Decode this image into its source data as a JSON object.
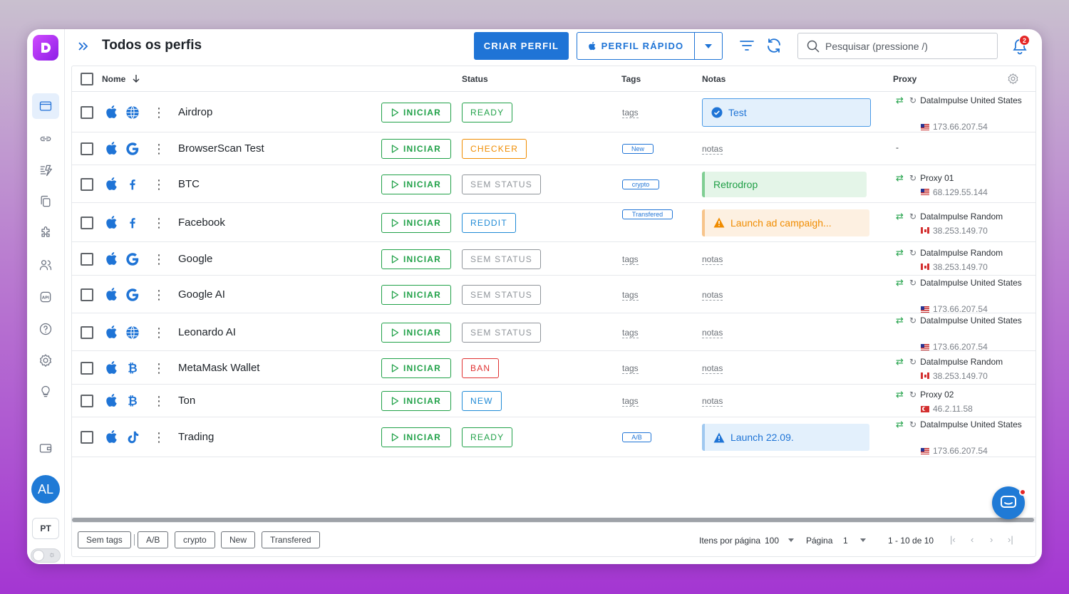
{
  "header": {
    "title": "Todos os perfis",
    "create_label": "CRIAR PERFIL",
    "quick_label": "PERFIL RÁPIDO",
    "search_placeholder": "Pesquisar (pressione /)",
    "notifications_count": "2"
  },
  "sidebar": {
    "items": [
      "profiles-icon",
      "link-icon",
      "automation-icon",
      "copy-icon",
      "extensions-icon",
      "team-icon",
      "api-icon",
      "help-icon",
      "settings-icon",
      "idea-icon",
      "wallet-icon"
    ],
    "avatar": "AL",
    "language": "PT"
  },
  "table": {
    "columns": {
      "name": "Nome",
      "status": "Status",
      "tags": "Tags",
      "notes": "Notas",
      "proxy": "Proxy"
    },
    "start_label": "INICIAR",
    "rows": [
      {
        "name": "Airdrop",
        "browser": "globe",
        "status": "READY",
        "status_color": "#20a148",
        "tags": "tags",
        "tag_chip": "",
        "note": "Test",
        "note_type": "info-check",
        "proxy_name": "DataImpulse United States",
        "proxy_ip": "173.66.207.54",
        "proxy_flag": "us"
      },
      {
        "name": "BrowserScan Test",
        "browser": "google",
        "status": "CHECKER",
        "status_color": "#f08c00",
        "tags": "",
        "tag_chip": "New",
        "note": "notas",
        "note_type": "link",
        "proxy_name": "-",
        "proxy_ip": "",
        "proxy_flag": ""
      },
      {
        "name": "BTC",
        "browser": "facebook",
        "status": "SEM STATUS",
        "status_color": "#8f949a",
        "tags": "",
        "tag_chip": "crypto",
        "note": "Retrodrop",
        "note_type": "success",
        "proxy_name": "Proxy 01",
        "proxy_ip": "68.129.55.144",
        "proxy_flag": "us"
      },
      {
        "name": "Facebook",
        "browser": "facebook",
        "status": "REDDIT",
        "status_color": "#1f8ad6",
        "tags": "",
        "tag_chip": "Transfered",
        "note": "Launch ad campaigh...",
        "note_type": "warning",
        "proxy_name": "DataImpulse Random",
        "proxy_ip": "38.253.149.70",
        "proxy_flag": "ca"
      },
      {
        "name": "Google",
        "browser": "google",
        "status": "SEM STATUS",
        "status_color": "#8f949a",
        "tags": "tags",
        "tag_chip": "",
        "note": "notas",
        "note_type": "link",
        "proxy_name": "DataImpulse Random",
        "proxy_ip": "38.253.149.70",
        "proxy_flag": "ca"
      },
      {
        "name": "Google AI",
        "browser": "google",
        "status": "SEM STATUS",
        "status_color": "#8f949a",
        "tags": "tags",
        "tag_chip": "",
        "note": "notas",
        "note_type": "link",
        "proxy_name": "DataImpulse United States",
        "proxy_ip": "173.66.207.54",
        "proxy_flag": "us"
      },
      {
        "name": "Leonardo AI",
        "browser": "globe",
        "status": "SEM STATUS",
        "status_color": "#8f949a",
        "tags": "tags",
        "tag_chip": "",
        "note": "notas",
        "note_type": "link",
        "proxy_name": "DataImpulse United States",
        "proxy_ip": "173.66.207.54",
        "proxy_flag": "us"
      },
      {
        "name": "MetaMask Wallet",
        "browser": "bitcoin",
        "status": "BAN",
        "status_color": "#e03131",
        "tags": "tags",
        "tag_chip": "",
        "note": "notas",
        "note_type": "link",
        "proxy_name": "DataImpulse Random",
        "proxy_ip": "38.253.149.70",
        "proxy_flag": "ca"
      },
      {
        "name": "Ton",
        "browser": "bitcoin",
        "status": "NEW",
        "status_color": "#1f8ad6",
        "tags": "tags",
        "tag_chip": "",
        "note": "notas",
        "note_type": "link",
        "proxy_name": "Proxy 02",
        "proxy_ip": "46.2.11.58",
        "proxy_flag": "tr"
      },
      {
        "name": "Trading",
        "browser": "tiktok",
        "status": "READY",
        "status_color": "#20a148",
        "tags": "",
        "tag_chip": "A/B",
        "note": "Launch 22.09.",
        "note_type": "info-warn",
        "proxy_name": "DataImpulse United States",
        "proxy_ip": "173.66.207.54",
        "proxy_flag": "us"
      }
    ]
  },
  "footer": {
    "tags": [
      "Sem tags",
      "A/B",
      "crypto",
      "New",
      "Transfered"
    ],
    "per_page_label": "Itens por página",
    "per_page": "100",
    "page_label": "Página",
    "page": "1",
    "range": "1 - 10 de 10"
  },
  "colors": {
    "primary": "#1f74d6",
    "success": "#20a148",
    "warning": "#f08c00",
    "danger": "#e03131",
    "muted": "#8f949a"
  }
}
